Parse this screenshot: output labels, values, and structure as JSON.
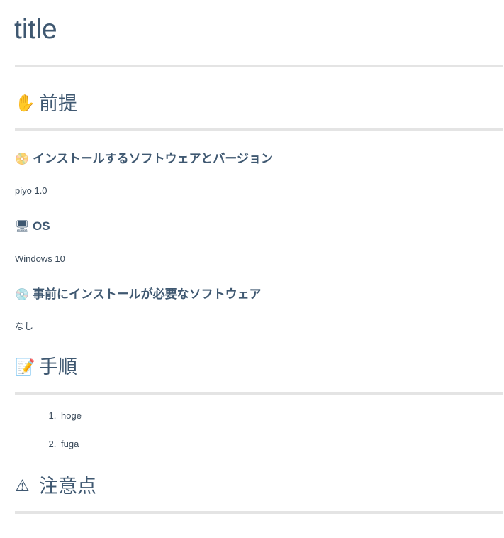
{
  "document": {
    "title": "title",
    "sections": [
      {
        "level": 2,
        "icon": "raised-hand-emoji",
        "icon_glyph": "✋",
        "heading": "前提"
      },
      {
        "level": 3,
        "icon": "dvd-emoji",
        "icon_glyph": "📀",
        "heading": "インストールするソフトウェアとバージョン",
        "body": "piyo 1.0"
      },
      {
        "level": 3,
        "icon": "desktop-computer-emoji",
        "icon_glyph": "🖥",
        "heading": "OS",
        "body": "Windows 10"
      },
      {
        "level": 3,
        "icon": "optical-disk-emoji",
        "icon_glyph": "💿",
        "heading": "事前にインストールが必要なソフトウェア",
        "body": "なし"
      },
      {
        "level": 2,
        "icon": "memo-emoji",
        "icon_glyph": "📝",
        "heading": "手順",
        "steps": [
          "hoge",
          "fuga"
        ]
      },
      {
        "level": 2,
        "icon": "warning-emoji",
        "icon_glyph": "⚠",
        "heading": "注意点"
      }
    ]
  },
  "colors": {
    "heading": "#3f5871",
    "body_text": "#3a4a5a",
    "rule": "#e4e4e4",
    "background": "#ffffff"
  }
}
